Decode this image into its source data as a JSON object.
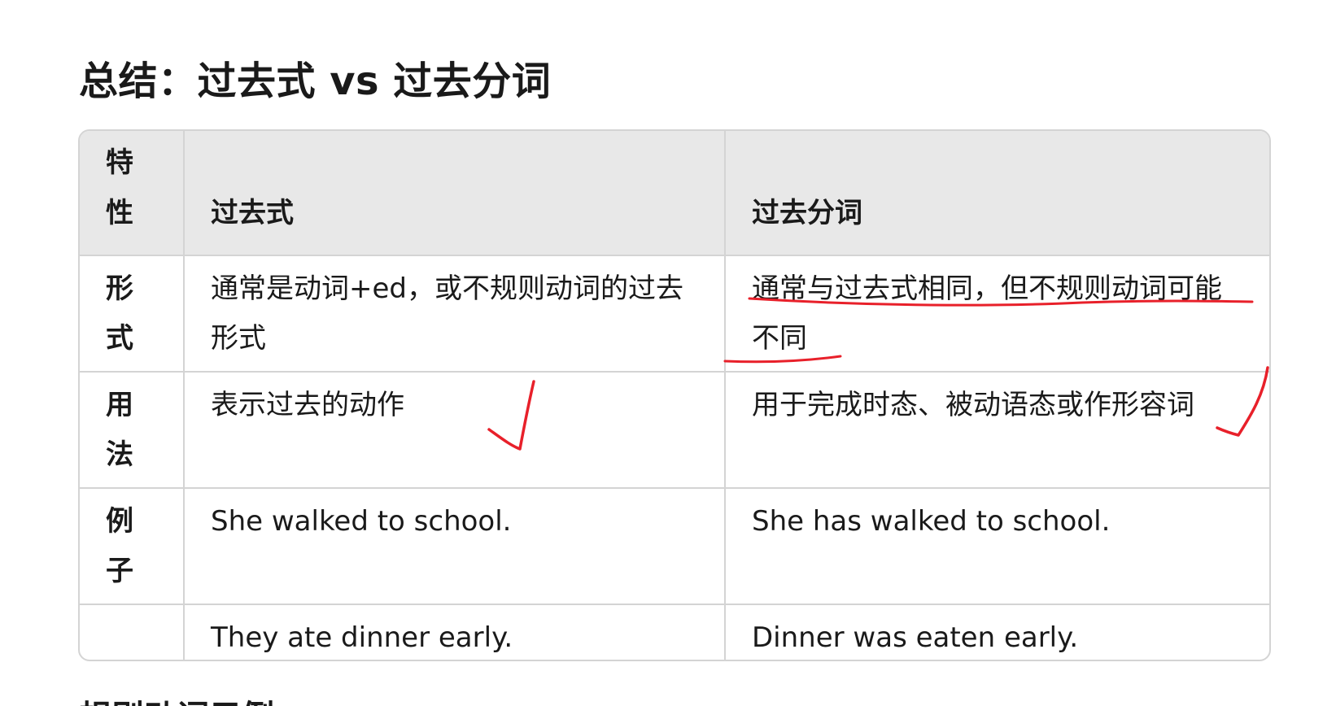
{
  "title": "总结：过去式 vs 过去分词",
  "table": {
    "headers": [
      "特性",
      "过去式",
      "过去分词"
    ],
    "rows": [
      {
        "feature": "形式",
        "past": "通常是动词+ed，或不规则动词的过去形式",
        "participle": "通常与过去式相同，但不规则动词可能不同"
      },
      {
        "feature": "用法",
        "past": "表示过去的动作",
        "participle": "用于完成时态、被动语态或作形容词"
      },
      {
        "feature": "例子",
        "past": "She walked to school.",
        "participle": "She has walked to school."
      },
      {
        "feature": "",
        "past": "They ate dinner early.",
        "participle": "Dinner was eaten early."
      }
    ]
  },
  "next_heading": "规则动词示例",
  "colors": {
    "header_bg": "#e8e8e8",
    "border": "#d4d4d4",
    "text": "#1a1a1a",
    "annotation": "#e8202a"
  },
  "annotations": [
    {
      "type": "underline",
      "target": "table.rows.0.participle"
    },
    {
      "type": "checkmark",
      "target": "table.rows.1.past"
    },
    {
      "type": "checkmark",
      "target": "table.rows.1.participle"
    }
  ]
}
